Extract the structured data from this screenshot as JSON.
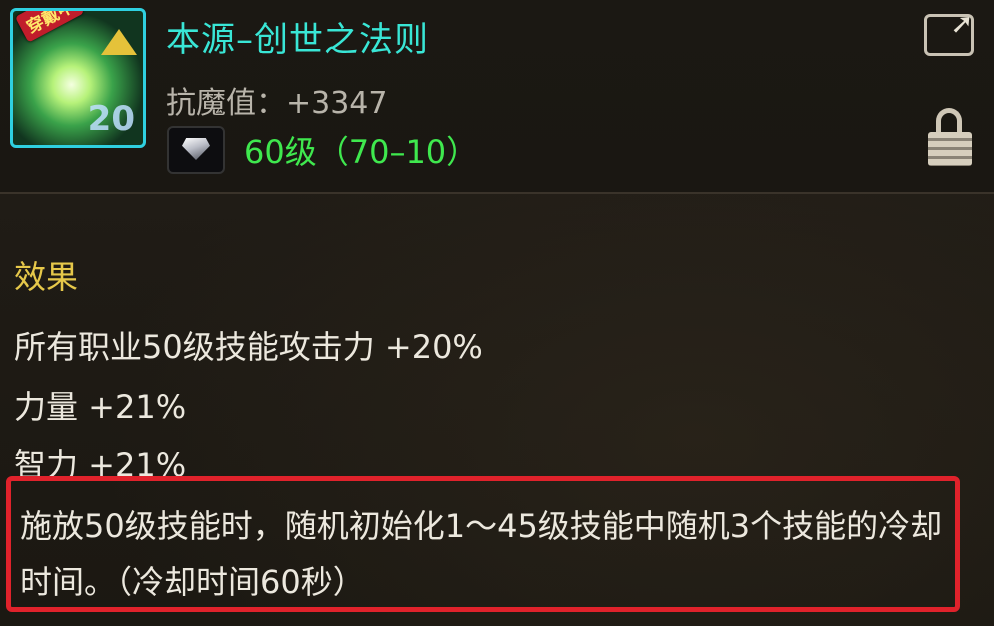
{
  "item": {
    "badge": "穿戴中",
    "icon_level": "20",
    "name": "本源–创世之法则",
    "stat": "抗魔值：+3347",
    "gem_level": "60级（70–10）"
  },
  "effects": {
    "title": "效果",
    "lines": [
      "所有职业50级技能攻击力 +20%",
      "力量 +21%",
      "智力 +21%"
    ],
    "description": "施放50级技能时，随机初始化1～45级技能中随机3个技能的冷却时间。（冷却时间60秒）"
  },
  "icons": {
    "share": "share-icon",
    "lock": "lock-icon",
    "gem": "diamond-gem-icon"
  },
  "colors": {
    "name": "#39e6d6",
    "gem_level": "#3fe84e",
    "section_title": "#e6c84a",
    "highlight_border": "#e0222b"
  }
}
